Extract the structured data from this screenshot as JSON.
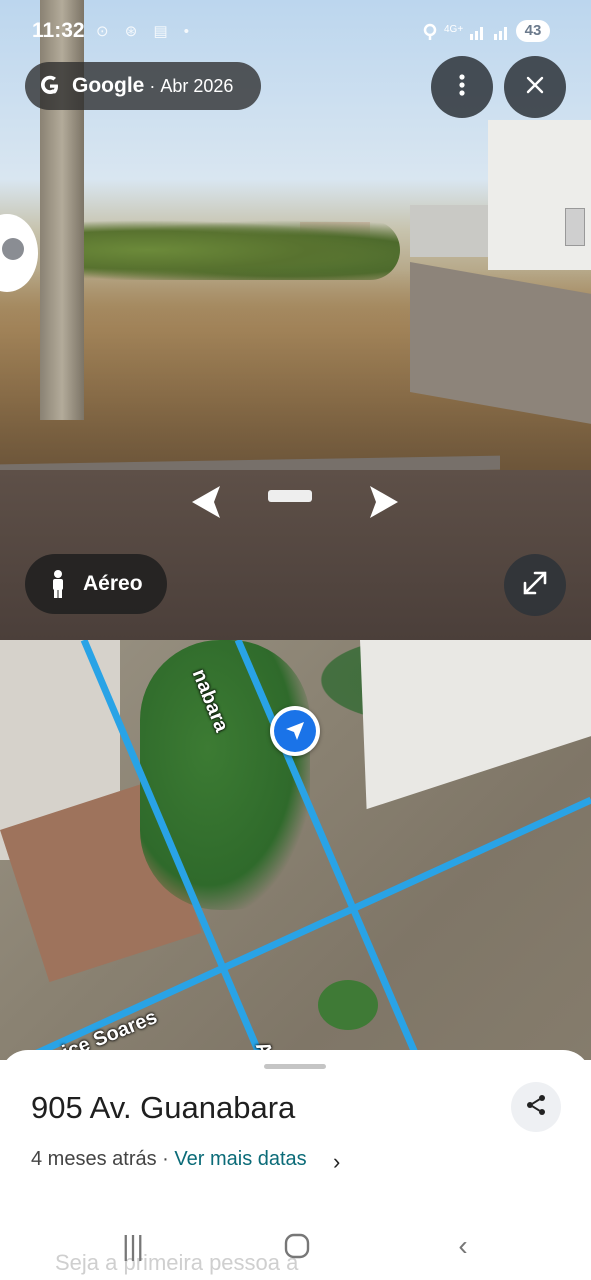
{
  "status_bar": {
    "time": "11:32",
    "left_icons": "⊙ ⊛ ▤ •",
    "network": "4G+",
    "battery": "43"
  },
  "street_view": {
    "attribution": {
      "brand": "Google",
      "separator": "·",
      "date": "Abr 2026"
    },
    "menu_icon": "more-vert-icon",
    "close_icon": "close-icon",
    "mode_button": {
      "label": "Aéreo",
      "icon": "person-icon"
    },
    "expand_icon": "expand-icon",
    "nav_prev_icon": "chevron-left-icon",
    "nav_next_icon": "chevron-right-icon"
  },
  "map": {
    "street_labels": {
      "label_1": "nabara",
      "label_2": "ice Soares",
      "label_3": "A"
    },
    "road_color": "#29a3e6",
    "location_color": "#1a73e8"
  },
  "sheet": {
    "address": "905 Av. Guanabara",
    "ago": "4 meses atrás",
    "dot": " · ",
    "more_dates": "Ver mais datas",
    "chevron": "›",
    "faded_text": "Seja a primeira pessoa a"
  },
  "nav_bar": {
    "recents": "|||",
    "home": "◯",
    "back": "‹"
  }
}
